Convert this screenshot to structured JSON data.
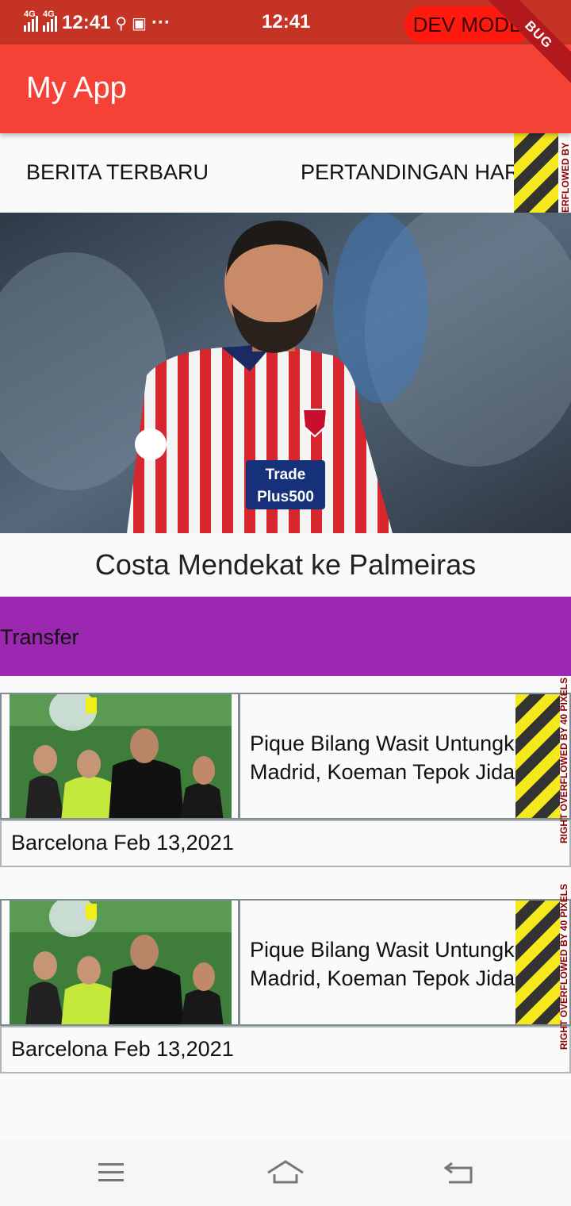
{
  "status_bar": {
    "network_1": "4G",
    "network_2": "4G",
    "time_left": "12:41",
    "more": "···",
    "time_center": "12:41",
    "dev_mode": "DEV MODE"
  },
  "debug_banner": "BUG",
  "app_bar": {
    "title": "My App"
  },
  "tabs": [
    {
      "label": "BERITA TERBARU"
    },
    {
      "label": "PERTANDINGAN HARI INI"
    }
  ],
  "overflow_labels": {
    "tabs": "ERFLOWED BY",
    "card_1": "RIGHT OVERFLOWED BY 40 PIXELS",
    "card_2": "RIGHT OVERFLOWED BY 40 PIXELS"
  },
  "headline": {
    "title": "Costa Mendekat ke Palmeiras",
    "image_icon": "football-player-photo",
    "sponsor_text": "Trade Plus500"
  },
  "category": {
    "label": "Transfer"
  },
  "news": [
    {
      "title_line_1": "Pique Bilang Wasit Untungkan",
      "title_line_2": "Madrid, Koeman Tepok Jidat",
      "meta": "Barcelona Feb 13,2021"
    },
    {
      "title_line_1": "Pique Bilang Wasit Untungkan",
      "title_line_2": "Madrid, Koeman Tepok Jidat",
      "meta": "Barcelona Feb 13,2021"
    }
  ],
  "nav_bar": {
    "menu_icon": "menu-icon",
    "home_icon": "home-icon",
    "back_icon": "back-icon"
  },
  "colors": {
    "status_bar": "#c53325",
    "app_bar": "#f44336",
    "category_bar": "#9c27b0",
    "dev_pill": "#ff1a10"
  }
}
